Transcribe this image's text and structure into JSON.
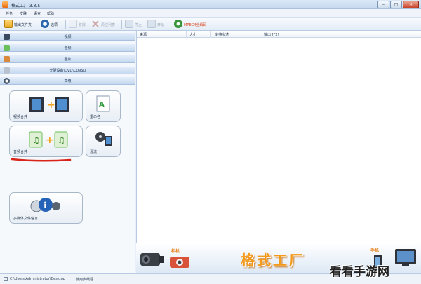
{
  "window": {
    "title": "格式工厂 3.3.5",
    "controls": {
      "minimize": "–",
      "maximize": "□",
      "close": "✕"
    }
  },
  "menu": {
    "items": [
      "任务",
      "皮肤",
      "语言",
      "帮助"
    ]
  },
  "toolbar": {
    "output_folder": "输出文件夹",
    "options": "选项",
    "remove": "移除",
    "clear_list": "清空列表",
    "stop": "停止",
    "start": "开始",
    "mpeg4_label": "MPEG4全解码"
  },
  "categories": {
    "video": "视频",
    "audio": "音频",
    "image": "图片",
    "rom": "光驱设备\\DVD\\CD\\ISO",
    "advanced": "高级"
  },
  "tools": {
    "video_merge": "视频合并",
    "rename": "重命名",
    "audio_merge": "音频合并",
    "mix": "混流",
    "media_info": "多媒体文件信息"
  },
  "file_list": {
    "columns": [
      "来源",
      "大小",
      "转换状态",
      "输出 [F2]"
    ]
  },
  "banner": {
    "brand": "格式工厂",
    "label_camera": "相机",
    "label_phone": "手机"
  },
  "status": {
    "path": "C:\\Users\\Administrator\\Desktop",
    "multithread": "使用多线程"
  },
  "watermark": "看看手游网",
  "colors": {
    "accent_orange": "#f39a1b",
    "underline_red": "#d9241a",
    "category_blue": "#c4d8f0"
  }
}
